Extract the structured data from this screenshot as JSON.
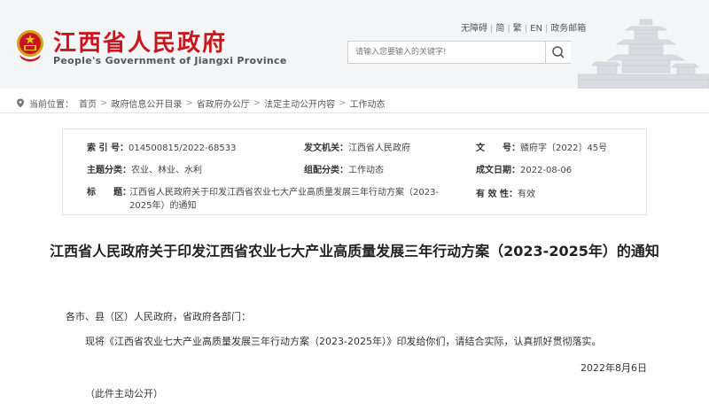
{
  "header": {
    "site_title": "江西省人民政府",
    "site_subtitle": "People's Government of Jiangxi Province",
    "top_links": [
      "无障碍",
      "简",
      "繁",
      "EN",
      "政务邮箱"
    ],
    "search_placeholder": "请输入您要输入的关键字!",
    "brand_color": "#c8161e"
  },
  "breadcrumb": {
    "label": "当前位置：",
    "items": [
      "首页",
      "政府信息公开目录",
      "省政府办公厅",
      "法定主动公开内容",
      "工作动态"
    ]
  },
  "info": {
    "index_label": "索  引  号：",
    "index_value": "014500815/2022-68533",
    "org_label": "发文机关：",
    "org_value": "江西省人民政府",
    "docno_label": "文　　号：",
    "docno_value": "赣府字〔2022〕45号",
    "topic_label": "主题分类：",
    "topic_value": "农业、林业、水利",
    "group_label": "组配分类：",
    "group_value": "工作动态",
    "date_label": "成文日期：",
    "date_value": "2022-08-06",
    "title_label": "标　　题：",
    "title_value": "江西省人民政府关于印发江西省农业七大产业高质量发展三年行动方案（2023-2025年）的通知",
    "validity_label": "有 效 性：",
    "validity_value": "有效"
  },
  "article": {
    "title": "江西省人民政府关于印发江西省农业七大产业高质量发展三年行动方案（2023-2025年）的通知",
    "salutation": "各市、县（区）人民政府，省政府各部门：",
    "body": "现将《江西省农业七大产业高质量发展三年行动方案（2023-2025年）》印发给你们，请结合实际，认真抓好贯彻落实。",
    "date": "2022年8月6日",
    "footnote": "（此件主动公开）"
  }
}
